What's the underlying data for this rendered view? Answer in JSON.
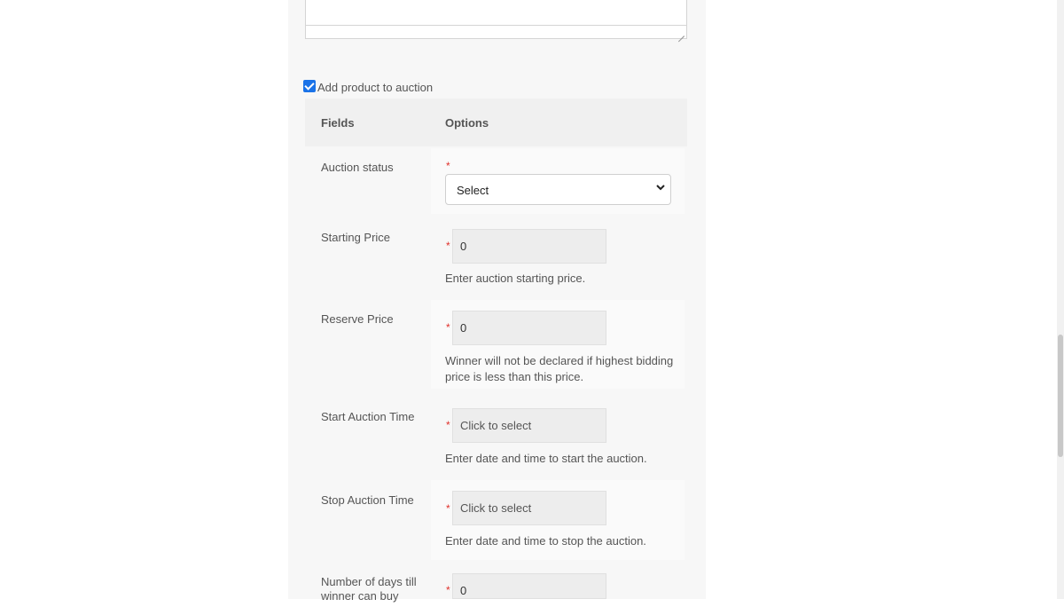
{
  "auction_toggle": {
    "checked": true,
    "label": "Add product to auction"
  },
  "table": {
    "header_fields": "Fields",
    "header_options": "Options"
  },
  "rows": {
    "auction_status": {
      "label": "Auction status",
      "select_value": "Select"
    },
    "starting_price": {
      "label": "Starting Price",
      "value": "0",
      "help": "Enter auction starting price."
    },
    "reserve_price": {
      "label": "Reserve Price",
      "value": "0",
      "help_line1": "Winner will not be declared if highest bidding",
      "help_line2": "price is less than this price."
    },
    "start_time": {
      "label": "Start Auction Time",
      "placeholder": "Click to select",
      "help": "Enter date and time to start the auction."
    },
    "stop_time": {
      "label": "Stop Auction Time",
      "placeholder": "Click to select",
      "help": "Enter date and time to stop the auction."
    },
    "days_till_buy": {
      "label_line1": "Number of days till",
      "label_line2": "winner can buy",
      "value": "0"
    }
  },
  "required_marker": "*",
  "icons": {
    "select_arrow": "chevron-down-icon",
    "checkbox": "checkmark-icon",
    "resize": "resize-handle-icon"
  },
  "colors": {
    "checkbox": "#1a73e8",
    "required": "#e0312b"
  }
}
